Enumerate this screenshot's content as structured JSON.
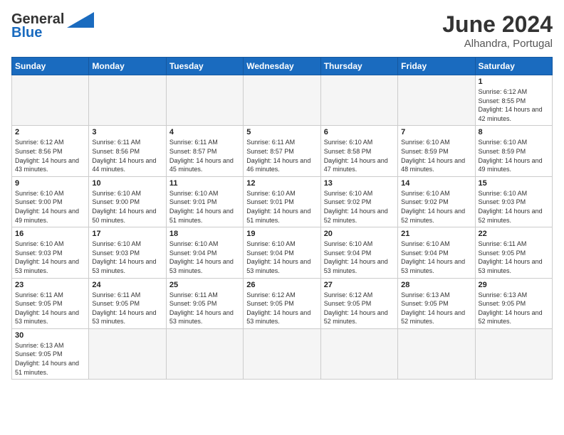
{
  "header": {
    "logo_general": "General",
    "logo_blue": "Blue",
    "month_title": "June 2024",
    "subtitle": "Alhandra, Portugal"
  },
  "days_of_week": [
    "Sunday",
    "Monday",
    "Tuesday",
    "Wednesday",
    "Thursday",
    "Friday",
    "Saturday"
  ],
  "weeks": [
    [
      {
        "day": "",
        "info": ""
      },
      {
        "day": "",
        "info": ""
      },
      {
        "day": "",
        "info": ""
      },
      {
        "day": "",
        "info": ""
      },
      {
        "day": "",
        "info": ""
      },
      {
        "day": "",
        "info": ""
      },
      {
        "day": "1",
        "info": "Sunrise: 6:12 AM\nSunset: 8:55 PM\nDaylight: 14 hours and 42 minutes."
      }
    ],
    [
      {
        "day": "2",
        "info": "Sunrise: 6:12 AM\nSunset: 8:56 PM\nDaylight: 14 hours and 43 minutes."
      },
      {
        "day": "3",
        "info": "Sunrise: 6:11 AM\nSunset: 8:56 PM\nDaylight: 14 hours and 44 minutes."
      },
      {
        "day": "4",
        "info": "Sunrise: 6:11 AM\nSunset: 8:57 PM\nDaylight: 14 hours and 45 minutes."
      },
      {
        "day": "5",
        "info": "Sunrise: 6:11 AM\nSunset: 8:57 PM\nDaylight: 14 hours and 46 minutes."
      },
      {
        "day": "6",
        "info": "Sunrise: 6:10 AM\nSunset: 8:58 PM\nDaylight: 14 hours and 47 minutes."
      },
      {
        "day": "7",
        "info": "Sunrise: 6:10 AM\nSunset: 8:59 PM\nDaylight: 14 hours and 48 minutes."
      },
      {
        "day": "8",
        "info": "Sunrise: 6:10 AM\nSunset: 8:59 PM\nDaylight: 14 hours and 49 minutes."
      }
    ],
    [
      {
        "day": "9",
        "info": "Sunrise: 6:10 AM\nSunset: 9:00 PM\nDaylight: 14 hours and 49 minutes."
      },
      {
        "day": "10",
        "info": "Sunrise: 6:10 AM\nSunset: 9:00 PM\nDaylight: 14 hours and 50 minutes."
      },
      {
        "day": "11",
        "info": "Sunrise: 6:10 AM\nSunset: 9:01 PM\nDaylight: 14 hours and 51 minutes."
      },
      {
        "day": "12",
        "info": "Sunrise: 6:10 AM\nSunset: 9:01 PM\nDaylight: 14 hours and 51 minutes."
      },
      {
        "day": "13",
        "info": "Sunrise: 6:10 AM\nSunset: 9:02 PM\nDaylight: 14 hours and 52 minutes."
      },
      {
        "day": "14",
        "info": "Sunrise: 6:10 AM\nSunset: 9:02 PM\nDaylight: 14 hours and 52 minutes."
      },
      {
        "day": "15",
        "info": "Sunrise: 6:10 AM\nSunset: 9:03 PM\nDaylight: 14 hours and 52 minutes."
      }
    ],
    [
      {
        "day": "16",
        "info": "Sunrise: 6:10 AM\nSunset: 9:03 PM\nDaylight: 14 hours and 53 minutes."
      },
      {
        "day": "17",
        "info": "Sunrise: 6:10 AM\nSunset: 9:03 PM\nDaylight: 14 hours and 53 minutes."
      },
      {
        "day": "18",
        "info": "Sunrise: 6:10 AM\nSunset: 9:04 PM\nDaylight: 14 hours and 53 minutes."
      },
      {
        "day": "19",
        "info": "Sunrise: 6:10 AM\nSunset: 9:04 PM\nDaylight: 14 hours and 53 minutes."
      },
      {
        "day": "20",
        "info": "Sunrise: 6:10 AM\nSunset: 9:04 PM\nDaylight: 14 hours and 53 minutes."
      },
      {
        "day": "21",
        "info": "Sunrise: 6:10 AM\nSunset: 9:04 PM\nDaylight: 14 hours and 53 minutes."
      },
      {
        "day": "22",
        "info": "Sunrise: 6:11 AM\nSunset: 9:05 PM\nDaylight: 14 hours and 53 minutes."
      }
    ],
    [
      {
        "day": "23",
        "info": "Sunrise: 6:11 AM\nSunset: 9:05 PM\nDaylight: 14 hours and 53 minutes."
      },
      {
        "day": "24",
        "info": "Sunrise: 6:11 AM\nSunset: 9:05 PM\nDaylight: 14 hours and 53 minutes."
      },
      {
        "day": "25",
        "info": "Sunrise: 6:11 AM\nSunset: 9:05 PM\nDaylight: 14 hours and 53 minutes."
      },
      {
        "day": "26",
        "info": "Sunrise: 6:12 AM\nSunset: 9:05 PM\nDaylight: 14 hours and 53 minutes."
      },
      {
        "day": "27",
        "info": "Sunrise: 6:12 AM\nSunset: 9:05 PM\nDaylight: 14 hours and 52 minutes."
      },
      {
        "day": "28",
        "info": "Sunrise: 6:13 AM\nSunset: 9:05 PM\nDaylight: 14 hours and 52 minutes."
      },
      {
        "day": "29",
        "info": "Sunrise: 6:13 AM\nSunset: 9:05 PM\nDaylight: 14 hours and 52 minutes."
      }
    ],
    [
      {
        "day": "30",
        "info": "Sunrise: 6:13 AM\nSunset: 9:05 PM\nDaylight: 14 hours and 51 minutes."
      },
      {
        "day": "",
        "info": ""
      },
      {
        "day": "",
        "info": ""
      },
      {
        "day": "",
        "info": ""
      },
      {
        "day": "",
        "info": ""
      },
      {
        "day": "",
        "info": ""
      },
      {
        "day": "",
        "info": ""
      }
    ]
  ]
}
